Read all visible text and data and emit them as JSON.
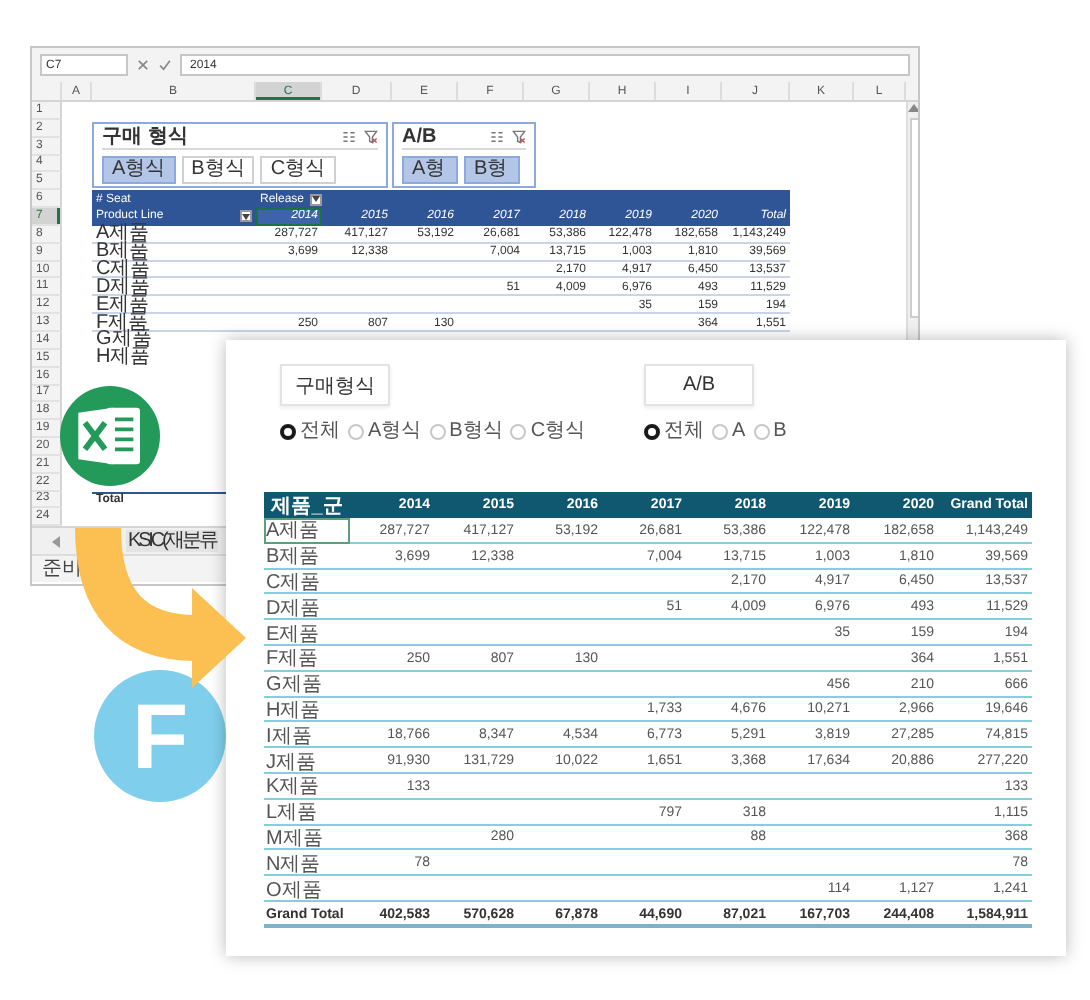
{
  "excel": {
    "name_box": "C7",
    "formula": "2014",
    "columns": [
      "A",
      "B",
      "C",
      "D",
      "E",
      "F",
      "G",
      "H",
      "I",
      "J",
      "K",
      "L"
    ],
    "row_numbers": [
      "1",
      "2",
      "3",
      "4",
      "5",
      "6",
      "7",
      "8",
      "9",
      "10",
      "11",
      "12",
      "13",
      "14",
      "15",
      "16",
      "17",
      "18",
      "19",
      "20",
      "21",
      "22",
      "23",
      "24"
    ],
    "slicers": [
      {
        "title": "구매 형식",
        "items": [
          {
            "label": "A형식",
            "selected": true
          },
          {
            "label": "B형식",
            "selected": false
          },
          {
            "label": "C형식",
            "selected": false
          }
        ]
      },
      {
        "title": "A/B",
        "items": [
          {
            "label": "A형",
            "selected": true
          },
          {
            "label": "B형",
            "selected": true
          }
        ]
      }
    ],
    "pivot": {
      "value_field": "# Seat",
      "column_field": "Release",
      "row_field": "Product Line",
      "headers": [
        {
          "label": "2014",
          "selected": true
        },
        {
          "label": "2015",
          "selected": false
        },
        {
          "label": "2016",
          "selected": false
        },
        {
          "label": "2017",
          "selected": false
        },
        {
          "label": "2018",
          "selected": false
        },
        {
          "label": "2019",
          "selected": false
        },
        {
          "label": "2020",
          "selected": false
        },
        {
          "label": "Total",
          "selected": false
        }
      ],
      "rows": [
        {
          "label": "A제품",
          "values": {
            "y2014": "287,727",
            "y2015": "417,127",
            "y2016": "53,192",
            "y2017": "26,681",
            "y2018": "53,386",
            "y2019": "122,478",
            "y2020": "182,658",
            "total": "1,143,249"
          }
        },
        {
          "label": "B제품",
          "values": {
            "y2014": "3,699",
            "y2015": "12,338",
            "y2017": "7,004",
            "y2018": "13,715",
            "y2019": "1,003",
            "y2020": "1,810",
            "total": "39,569"
          }
        },
        {
          "label": "C제품",
          "values": {
            "y2018": "2,170",
            "y2019": "4,917",
            "y2020": "6,450",
            "total": "13,537"
          }
        },
        {
          "label": "D제품",
          "values": {
            "y2017": "51",
            "y2018": "4,009",
            "y2019": "6,976",
            "y2020": "493",
            "total": "11,529"
          }
        },
        {
          "label": "E제품",
          "values": {
            "y2019": "35",
            "y2020": "159",
            "total": "194"
          }
        },
        {
          "label": "F제품",
          "values": {
            "y2014": "250",
            "y2015": "807",
            "y2016": "130",
            "y2020": "364",
            "total": "1,551"
          }
        },
        {
          "label": "G제품"
        },
        {
          "label": "H제품"
        }
      ],
      "total_label": "Total"
    },
    "sheet_tabs": [
      {
        "label": "KSIC(재분류"
      }
    ],
    "status": "준비"
  },
  "logo_letter": "F",
  "report": {
    "slicers": [
      {
        "title": "구매형식",
        "options": [
          {
            "label": "전체",
            "selected": true
          },
          {
            "label": "A형식",
            "selected": false
          },
          {
            "label": "B형식",
            "selected": false
          },
          {
            "label": "C형식",
            "selected": false
          }
        ]
      },
      {
        "title": "A/B",
        "options": [
          {
            "label": "전체",
            "selected": true
          },
          {
            "label": "A",
            "selected": false
          },
          {
            "label": "B",
            "selected": false
          }
        ]
      }
    ],
    "table": {
      "columns": [
        "제품_군",
        "2014",
        "2015",
        "2016",
        "2017",
        "2018",
        "2019",
        "2020",
        "Grand Total"
      ],
      "rows": [
        {
          "label": "A제품",
          "selected": true,
          "values": {
            "y2014": "287,727",
            "y2015": "417,127",
            "y2016": "53,192",
            "y2017": "26,681",
            "y2018": "53,386",
            "y2019": "122,478",
            "y2020": "182,658",
            "total": "1,143,249"
          }
        },
        {
          "label": "B제품",
          "selected": false,
          "values": {
            "y2014": "3,699",
            "y2015": "12,338",
            "y2017": "7,004",
            "y2018": "13,715",
            "y2019": "1,003",
            "y2020": "1,810",
            "total": "39,569"
          }
        },
        {
          "label": "C제품",
          "selected": false,
          "values": {
            "y2018": "2,170",
            "y2019": "4,917",
            "y2020": "6,450",
            "total": "13,537"
          }
        },
        {
          "label": "D제품",
          "selected": false,
          "values": {
            "y2017": "51",
            "y2018": "4,009",
            "y2019": "6,976",
            "y2020": "493",
            "total": "11,529"
          }
        },
        {
          "label": "E제품",
          "selected": false,
          "values": {
            "y2019": "35",
            "y2020": "159",
            "total": "194"
          }
        },
        {
          "label": "F제품",
          "selected": false,
          "values": {
            "y2014": "250",
            "y2015": "807",
            "y2016": "130",
            "y2020": "364",
            "total": "1,551"
          }
        },
        {
          "label": "G제품",
          "selected": false,
          "values": {
            "y2019": "456",
            "y2020": "210",
            "total": "666"
          }
        },
        {
          "label": "H제품",
          "selected": false,
          "values": {
            "y2017": "1,733",
            "y2018": "4,676",
            "y2019": "10,271",
            "y2020": "2,966",
            "total": "19,646"
          }
        },
        {
          "label": "I제품",
          "selected": false,
          "values": {
            "y2014": "18,766",
            "y2015": "8,347",
            "y2016": "4,534",
            "y2017": "6,773",
            "y2018": "5,291",
            "y2019": "3,819",
            "y2020": "27,285",
            "total": "74,815"
          }
        },
        {
          "label": "J제품",
          "selected": false,
          "values": {
            "y2014": "91,930",
            "y2015": "131,729",
            "y2016": "10,022",
            "y2017": "1,651",
            "y2018": "3,368",
            "y2019": "17,634",
            "y2020": "20,886",
            "total": "277,220"
          }
        },
        {
          "label": "K제품",
          "selected": false,
          "values": {
            "y2014": "133",
            "total": "133"
          }
        },
        {
          "label": "L제품",
          "selected": false,
          "values": {
            "y2017": "797",
            "y2018": "318",
            "total": "1,115"
          }
        },
        {
          "label": "M제품",
          "selected": false,
          "values": {
            "y2015": "280",
            "y2018": "88",
            "total": "368"
          }
        },
        {
          "label": "N제품",
          "selected": false,
          "values": {
            "y2014": "78",
            "total": "78"
          }
        },
        {
          "label": "O제품",
          "selected": false,
          "values": {
            "y2019": "114",
            "y2020": "1,127",
            "total": "1,241"
          }
        }
      ],
      "total": {
        "label": "Grand Total",
        "values": {
          "y2014": "402,583",
          "y2015": "570,628",
          "y2016": "67,878",
          "y2017": "44,690",
          "y2018": "87,021",
          "y2019": "167,703",
          "y2020": "244,408",
          "total": "1,584,911"
        }
      }
    }
  }
}
